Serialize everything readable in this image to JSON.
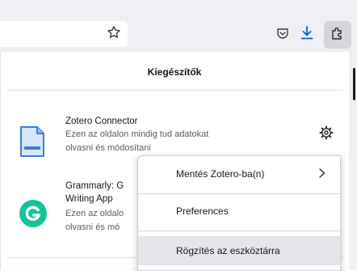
{
  "toolbar": {
    "icons": [
      "star-icon",
      "pocket-icon",
      "download-icon",
      "extensions-icon"
    ],
    "accent_color": "#0060df"
  },
  "panel": {
    "title": "Kiegészítők",
    "extensions": [
      {
        "name": "Zotero Connector",
        "description_line1": "Ezen az oldalon mindig tud adatokat",
        "description_line2": "olvasni és módosítani",
        "icon": "document-icon"
      },
      {
        "name_line1": "Grammarly: G",
        "name_line2": "Writing App",
        "description_line1": "Ezen az oldalo",
        "description_line2": "olvasni és mó",
        "icon": "grammarly-icon",
        "icon_color": "#15c39a"
      }
    ]
  },
  "context_menu": {
    "items": [
      {
        "label": "Mentés Zotero-ba(n)"
      },
      {
        "label": "Preferences"
      },
      {
        "label": "Rögzítés az eszköztárra"
      }
    ]
  }
}
